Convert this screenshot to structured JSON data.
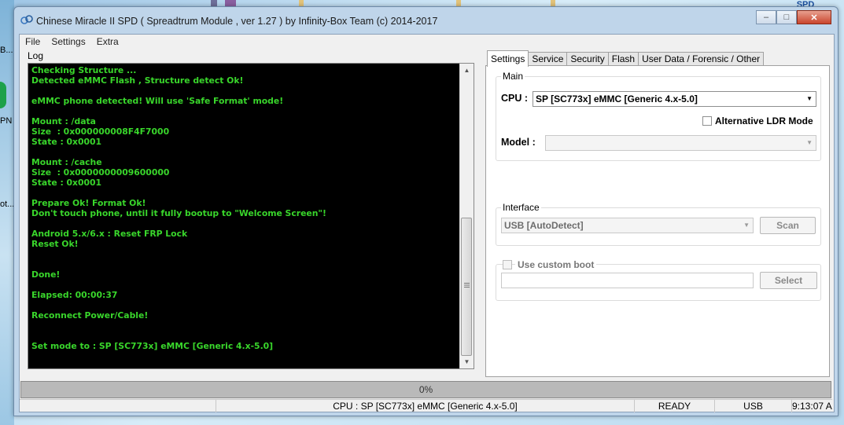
{
  "window": {
    "title": "Chinese Miracle II SPD ( Spreadtrum Module , ver 1.27 ) by Infinity-Box Team (c) 2014-2017"
  },
  "desktop": {
    "left_labels": [
      "B...",
      "PN",
      "ot..."
    ],
    "badge": "SPD"
  },
  "menu": [
    "File",
    "Settings",
    "Extra"
  ],
  "log": {
    "label": "Log",
    "lines": [
      "Checking Structure ...",
      "Detected eMMC Flash , Structure detect Ok!",
      "",
      "eMMC phone detected! Will use 'Safe Format' mode!",
      "",
      "Mount : /data",
      "Size  : 0x000000008F4F7000",
      "State : 0x0001",
      "",
      "Mount : /cache",
      "Size  : 0x0000000009600000",
      "State : 0x0001",
      "",
      "Prepare Ok! Format Ok!",
      "Don't touch phone, until it fully bootup to \"Welcome Screen\"!",
      "",
      "Android 5.x/6.x : Reset FRP Lock",
      "Reset Ok!",
      "",
      "",
      "Done!",
      "",
      "Elapsed: 00:00:37",
      "",
      "Reconnect Power/Cable!",
      "",
      "",
      "Set mode to : SP [SC773x] eMMC [Generic 4.x-5.0]"
    ]
  },
  "tabs": [
    {
      "label": "Settings",
      "active": true
    },
    {
      "label": "Service",
      "active": false
    },
    {
      "label": "Security",
      "active": false
    },
    {
      "label": "Flash",
      "active": false
    },
    {
      "label": "User Data / Forensic / Other",
      "active": false
    }
  ],
  "settings": {
    "main_group": "Main",
    "cpu_label": "CPU :",
    "cpu_value": "SP [SC773x] eMMC [Generic 4.x-5.0]",
    "alt_ldr_label": "Alternative LDR Mode",
    "model_label": "Model :",
    "model_value": "",
    "interface_group": "Interface",
    "interface_value": "USB [AutoDetect]",
    "scan_label": "Scan",
    "custom_boot_label": "Use custom boot",
    "custom_boot_path": "",
    "select_label": "Select"
  },
  "progress": {
    "value": 0,
    "text": "0%"
  },
  "statusbar": {
    "blank": "",
    "cpu": "CPU : SP [SC773x] eMMC [Generic 4.x-5.0]",
    "state": "READY",
    "interface": "USB",
    "time": "9:13:07 AM"
  },
  "colors": {
    "log_bg": "#000000",
    "log_text": "#39d62b",
    "progress_fill": "#36b34a"
  },
  "icons": [
    "app-icon",
    "minimize-icon",
    "maximize-icon",
    "close-icon",
    "chevron-down-icon"
  ]
}
